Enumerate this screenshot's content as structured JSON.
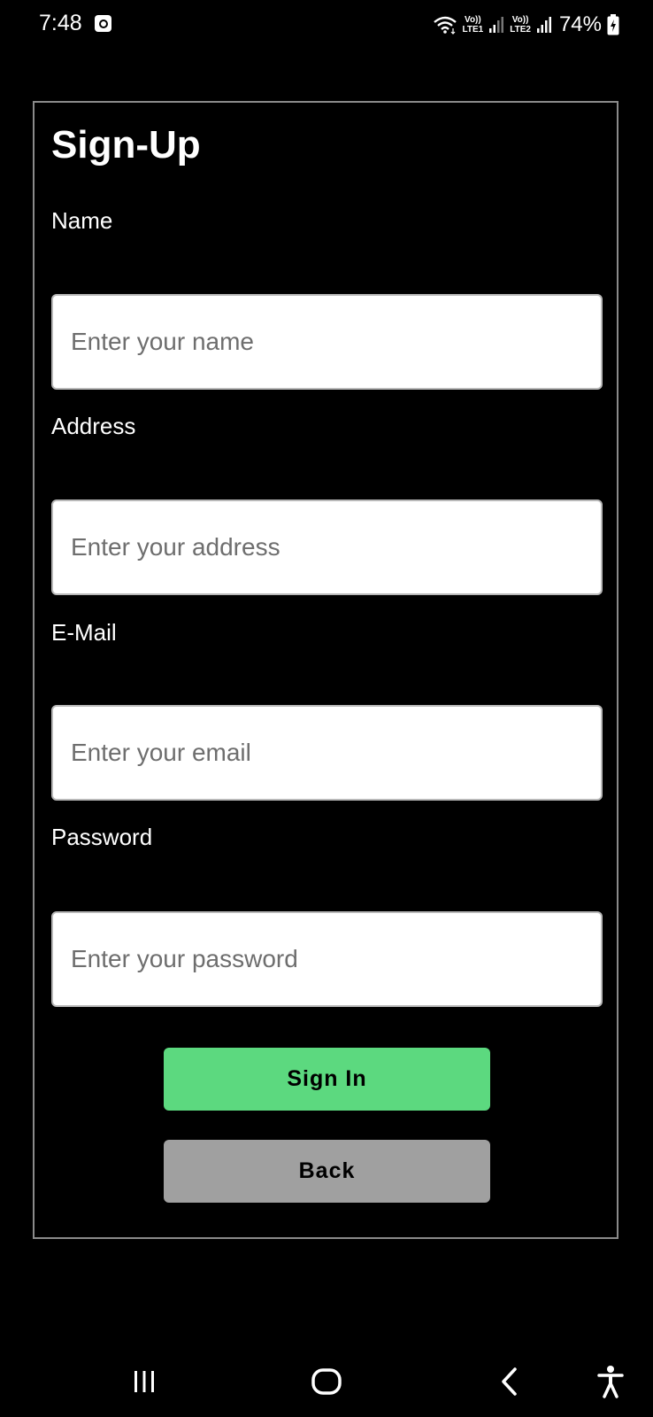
{
  "status_bar": {
    "time": "7:48",
    "sim1_top": "Vo))",
    "sim1_bottom": "LTE1",
    "sim2_top": "Vo))",
    "sim2_bottom": "LTE2",
    "battery": "74%",
    "icons": [
      "notification-icon",
      "wifi-icon",
      "signal-icon",
      "signal-icon",
      "battery-charging-icon"
    ]
  },
  "form": {
    "title": "Sign-Up",
    "fields": [
      {
        "label": "Name",
        "placeholder": "Enter your name",
        "value": ""
      },
      {
        "label": "Address",
        "placeholder": "Enter your address",
        "value": ""
      },
      {
        "label": "E-Mail",
        "placeholder": "Enter your email",
        "value": ""
      },
      {
        "label": "Password",
        "placeholder": "Enter your password",
        "value": ""
      }
    ],
    "sign_in_label": "Sign In",
    "back_label": "Back"
  },
  "nav_bar": {
    "icons": [
      "recent-apps-icon",
      "home-icon",
      "back-icon",
      "accessibility-icon"
    ]
  },
  "colors": {
    "background": "#000000",
    "sign_in_button": "#5cd97f",
    "back_button": "#a0a0a0",
    "card_border": "#8a8a8a"
  }
}
